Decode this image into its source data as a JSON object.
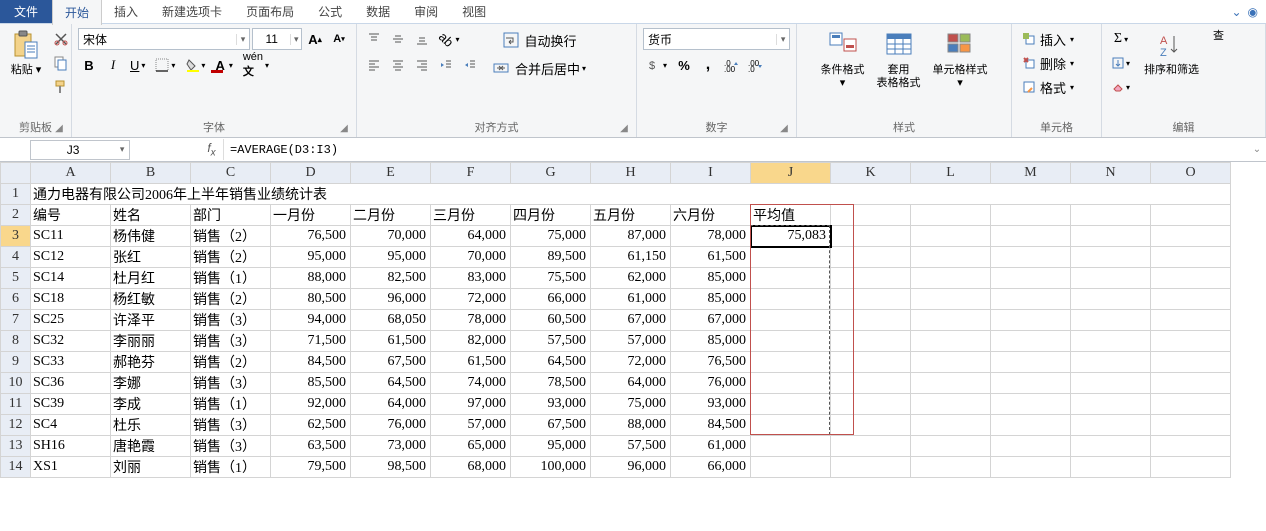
{
  "tabs": {
    "file": "文件",
    "items": [
      "开始",
      "插入",
      "新建选项卡",
      "页面布局",
      "公式",
      "数据",
      "审阅",
      "视图"
    ],
    "active_index": 0
  },
  "ribbon": {
    "clipboard": {
      "paste": "粘贴",
      "label": "剪贴板"
    },
    "font": {
      "name": "宋体",
      "size": "11",
      "label": "字体"
    },
    "alignment": {
      "wrap": "自动换行",
      "merge": "合并后居中",
      "label": "对齐方式"
    },
    "number": {
      "format": "货币",
      "label": "数字"
    },
    "styles": {
      "conditional": "条件格式",
      "table": "套用\n表格格式",
      "cell": "单元格样式",
      "label": "样式"
    },
    "cells": {
      "insert": "插入",
      "delete": "删除",
      "format": "格式",
      "label": "单元格"
    },
    "editing": {
      "sort": "排序和筛选",
      "find": "查",
      "label": "编辑"
    }
  },
  "formula_bar": {
    "name_box": "J3",
    "formula": "=AVERAGE(D3:I3)"
  },
  "grid": {
    "columns": [
      "A",
      "B",
      "C",
      "D",
      "E",
      "F",
      "G",
      "H",
      "I",
      "J",
      "K",
      "L",
      "M",
      "N",
      "O"
    ],
    "active_col": "J",
    "active_row": 3,
    "title_row": {
      "row": 1,
      "text": "通力电器有限公司2006年上半年销售业绩统计表"
    },
    "header_row": {
      "row": 2,
      "cells": [
        "编号",
        "姓名",
        "部门",
        "一月份",
        "二月份",
        "三月份",
        "四月份",
        "五月份",
        "六月份",
        "平均值"
      ]
    },
    "data_rows": [
      {
        "row": 3,
        "id": "SC11",
        "name": "杨伟健",
        "dept": "销售（2）",
        "m": [
          "76,500",
          "70,000",
          "64,000",
          "75,000",
          "87,000",
          "78,000"
        ],
        "avg": "75,083"
      },
      {
        "row": 4,
        "id": "SC12",
        "name": "张红",
        "dept": "销售（2）",
        "m": [
          "95,000",
          "95,000",
          "70,000",
          "89,500",
          "61,150",
          "61,500"
        ],
        "avg": ""
      },
      {
        "row": 5,
        "id": "SC14",
        "name": "杜月红",
        "dept": "销售（1）",
        "m": [
          "88,000",
          "82,500",
          "83,000",
          "75,500",
          "62,000",
          "85,000"
        ],
        "avg": ""
      },
      {
        "row": 6,
        "id": "SC18",
        "name": "杨红敏",
        "dept": "销售（2）",
        "m": [
          "80,500",
          "96,000",
          "72,000",
          "66,000",
          "61,000",
          "85,000"
        ],
        "avg": ""
      },
      {
        "row": 7,
        "id": "SC25",
        "name": "许泽平",
        "dept": "销售（3）",
        "m": [
          "94,000",
          "68,050",
          "78,000",
          "60,500",
          "67,000",
          "67,000"
        ],
        "avg": ""
      },
      {
        "row": 8,
        "id": "SC32",
        "name": "李丽丽",
        "dept": "销售（3）",
        "m": [
          "71,500",
          "61,500",
          "82,000",
          "57,500",
          "57,000",
          "85,000"
        ],
        "avg": ""
      },
      {
        "row": 9,
        "id": "SC33",
        "name": "郝艳芬",
        "dept": "销售（2）",
        "m": [
          "84,500",
          "67,500",
          "61,500",
          "64,500",
          "72,000",
          "76,500"
        ],
        "avg": ""
      },
      {
        "row": 10,
        "id": "SC36",
        "name": "李娜",
        "dept": "销售（3）",
        "m": [
          "85,500",
          "64,500",
          "74,000",
          "78,500",
          "64,000",
          "76,000"
        ],
        "avg": ""
      },
      {
        "row": 11,
        "id": "SC39",
        "name": "李成",
        "dept": "销售（1）",
        "m": [
          "92,000",
          "64,000",
          "97,000",
          "93,000",
          "75,000",
          "93,000"
        ],
        "avg": ""
      },
      {
        "row": 12,
        "id": "SC4",
        "name": "杜乐",
        "dept": "销售（3）",
        "m": [
          "62,500",
          "76,000",
          "57,000",
          "67,500",
          "88,000",
          "84,500"
        ],
        "avg": ""
      },
      {
        "row": 13,
        "id": "SH16",
        "name": "唐艳霞",
        "dept": "销售（3）",
        "m": [
          "63,500",
          "73,000",
          "65,000",
          "95,000",
          "57,500",
          "61,000"
        ],
        "avg": ""
      },
      {
        "row": 14,
        "id": "XS1",
        "name": "刘丽",
        "dept": "销售（1）",
        "m": [
          "79,500",
          "98,500",
          "68,000",
          "100,000",
          "96,000",
          "66,000"
        ],
        "avg": ""
      }
    ]
  }
}
